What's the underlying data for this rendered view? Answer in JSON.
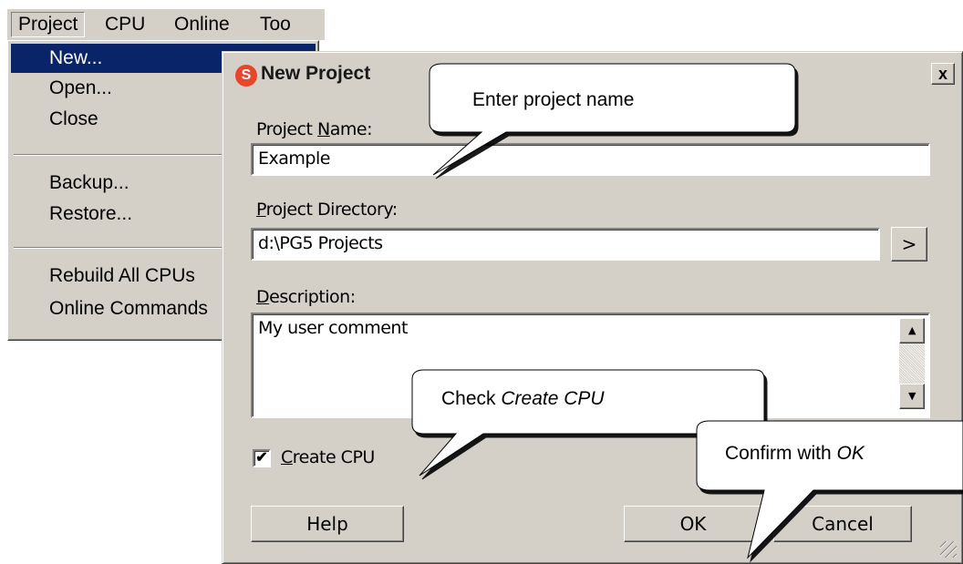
{
  "menubar": {
    "items": [
      "Project",
      "CPU",
      "Online",
      "Too"
    ]
  },
  "project_menu": {
    "items": [
      {
        "label": "New..."
      },
      {
        "label": "Open..."
      },
      {
        "label": "Close"
      },
      {
        "label": "Backup..."
      },
      {
        "label": "Restore..."
      },
      {
        "label": "Rebuild All CPUs"
      },
      {
        "label": "Online Commands"
      }
    ]
  },
  "dialog": {
    "title": "New Project",
    "close_glyph": "x",
    "project_name_label_pre": "Project ",
    "project_name_label_acc": "N",
    "project_name_label_post": "ame:",
    "project_name_value": "Example",
    "project_dir_label_acc": "P",
    "project_dir_label_post": "roject Directory:",
    "project_dir_value": "d:\\PG5 Projects",
    "browse_label": ">",
    "description_label_acc": "D",
    "description_label_post": "escription:",
    "description_value": "My user comment",
    "create_cpu_checked": true,
    "create_cpu_check_glyph": "✔",
    "create_cpu_label_acc": "C",
    "create_cpu_label_post": "reate CPU",
    "help_label": "Help",
    "ok_label": "OK",
    "cancel_label": "Cancel"
  },
  "callouts": {
    "enter_name": "Enter project name",
    "check_cpu_pre": "Check ",
    "check_cpu_em": "Create CPU",
    "confirm_pre": "Confirm with ",
    "confirm_em": "OK"
  },
  "icons": {
    "app": "pg5-logo-icon",
    "close": "close-icon",
    "scroll_up": "scroll-up-icon",
    "scroll_down": "scroll-down-icon",
    "grip": "resize-grip-icon"
  },
  "colors": {
    "menu_highlight": "#0a246a",
    "face": "#d4d0c8",
    "logo": "#e8452a"
  }
}
